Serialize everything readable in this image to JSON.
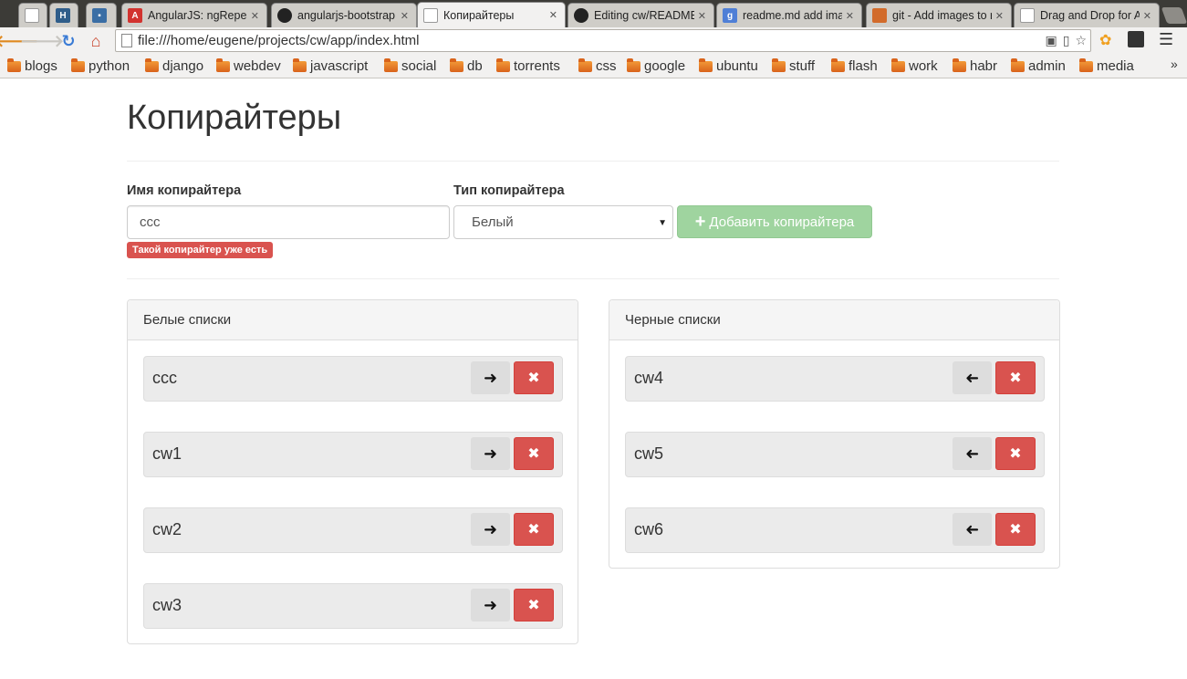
{
  "browser": {
    "tabs": [
      {
        "label": "",
        "icon": "page-icon"
      },
      {
        "label": "",
        "icon": "h-icon"
      },
      {
        "label": "",
        "icon": "message-icon"
      },
      {
        "label": "AngularJS: ngRepeat",
        "icon": "angular-icon"
      },
      {
        "label": "angularjs-bootstrap",
        "icon": "github-icon"
      },
      {
        "label": "Копирайтеры",
        "icon": "page-icon",
        "active": true
      },
      {
        "label": "Editing cw/READMEm",
        "icon": "github-icon"
      },
      {
        "label": "readme.md add image",
        "icon": "google-icon"
      },
      {
        "label": "git - Add images to re",
        "icon": "git-icon"
      },
      {
        "label": "Drag and Drop for A",
        "icon": "page-icon"
      }
    ],
    "url": "file:///home/eugene/projects/cw/app/index.html",
    "bookmarks": [
      "blogs",
      "python",
      "django",
      "webdev",
      "javascript",
      "social",
      "db",
      "torrents",
      "css",
      "google",
      "ubuntu",
      "stuff",
      "flash",
      "work",
      "habr",
      "admin",
      "media"
    ],
    "more_bookmarks": "»"
  },
  "page": {
    "title": "Копирайтеры",
    "form": {
      "name_label": "Имя копирайтера",
      "name_value": "ccc",
      "type_label": "Тип копирайтера",
      "type_value": "Белый",
      "add_button_label": "Добавить копирайтера",
      "error_text": "Такой копирайтер уже есть"
    },
    "white_panel": {
      "title": "Белые списки",
      "items": [
        "ccc",
        "cw1",
        "cw2",
        "cw3"
      ],
      "move_icon": "arrow-right-icon"
    },
    "black_panel": {
      "title": "Черные списки",
      "items": [
        "cw4",
        "cw5",
        "cw6"
      ],
      "move_icon": "arrow-left-icon"
    },
    "colors": {
      "danger": "#d9534f",
      "success_disabled": "#9fd49f"
    }
  }
}
